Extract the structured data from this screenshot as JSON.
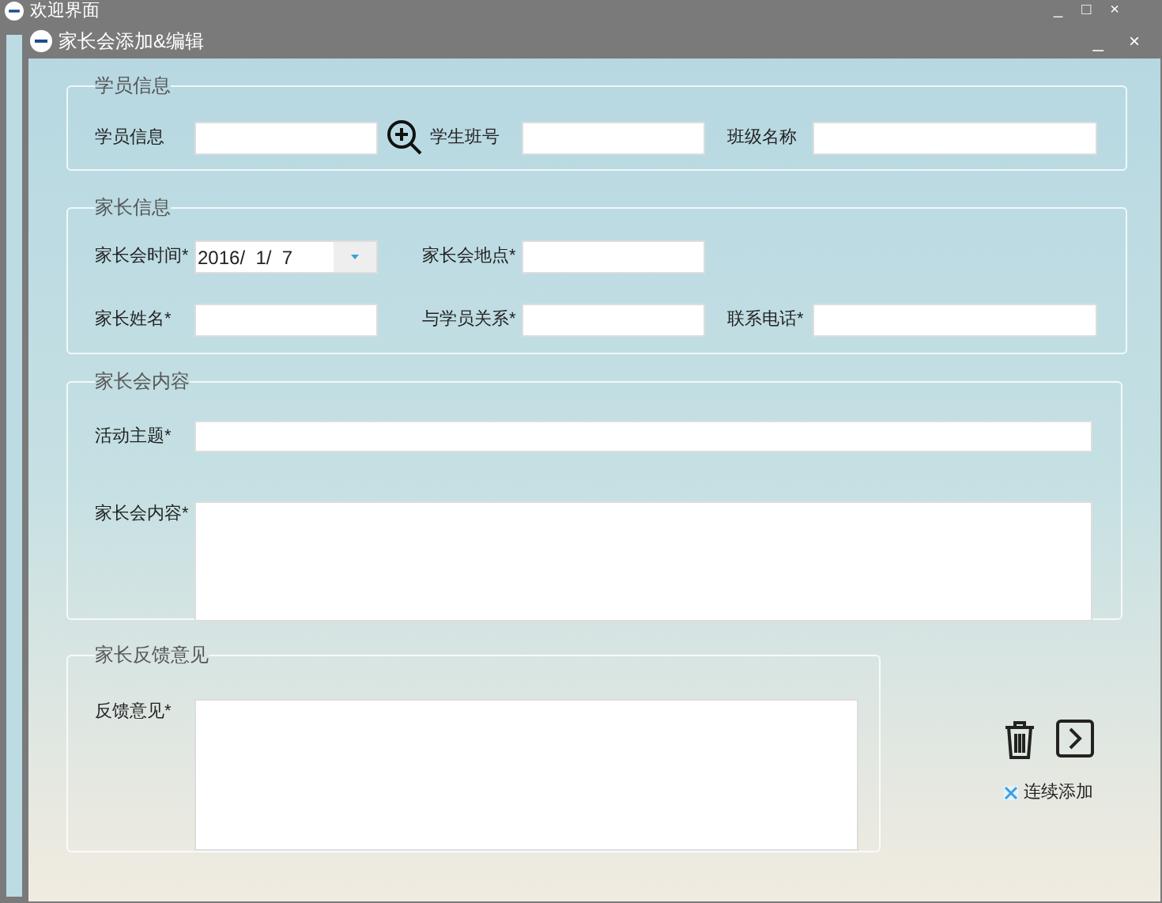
{
  "back_window": {
    "title": "欢迎界面",
    "controls": [
      "_",
      "□",
      "×"
    ]
  },
  "window": {
    "title": "家长会添加&编辑",
    "controls": [
      "_",
      "×"
    ]
  },
  "groups": [
    {
      "title": "学员信息",
      "rows": [
        [
          {
            "kind": "text",
            "label": "学员信息"
          },
          {
            "kind": "search"
          },
          {
            "kind": "text",
            "label": "学生班号"
          },
          {
            "kind": "text",
            "label": "班级名称"
          }
        ]
      ]
    },
    {
      "title": "家长信息",
      "rows": [
        [
          {
            "kind": "date",
            "label": "家长会时间*",
            "value": "2016/  1/  7"
          },
          {
            "kind": "text",
            "label": "家长会地点*"
          }
        ],
        [
          {
            "kind": "text",
            "label": "家长姓名*"
          },
          {
            "kind": "text",
            "label": "与学员关系*"
          },
          {
            "kind": "text",
            "label": "联系电话*"
          }
        ]
      ]
    }
  ],
  "content": {
    "title": "家长会内容",
    "topic_label": "活动主题*",
    "body_label": "家长会内容*"
  },
  "feedback": {
    "title": "家长反馈意见",
    "label": "反馈意见*"
  },
  "continuous_add": {
    "label": "连续添加",
    "checked": true
  }
}
